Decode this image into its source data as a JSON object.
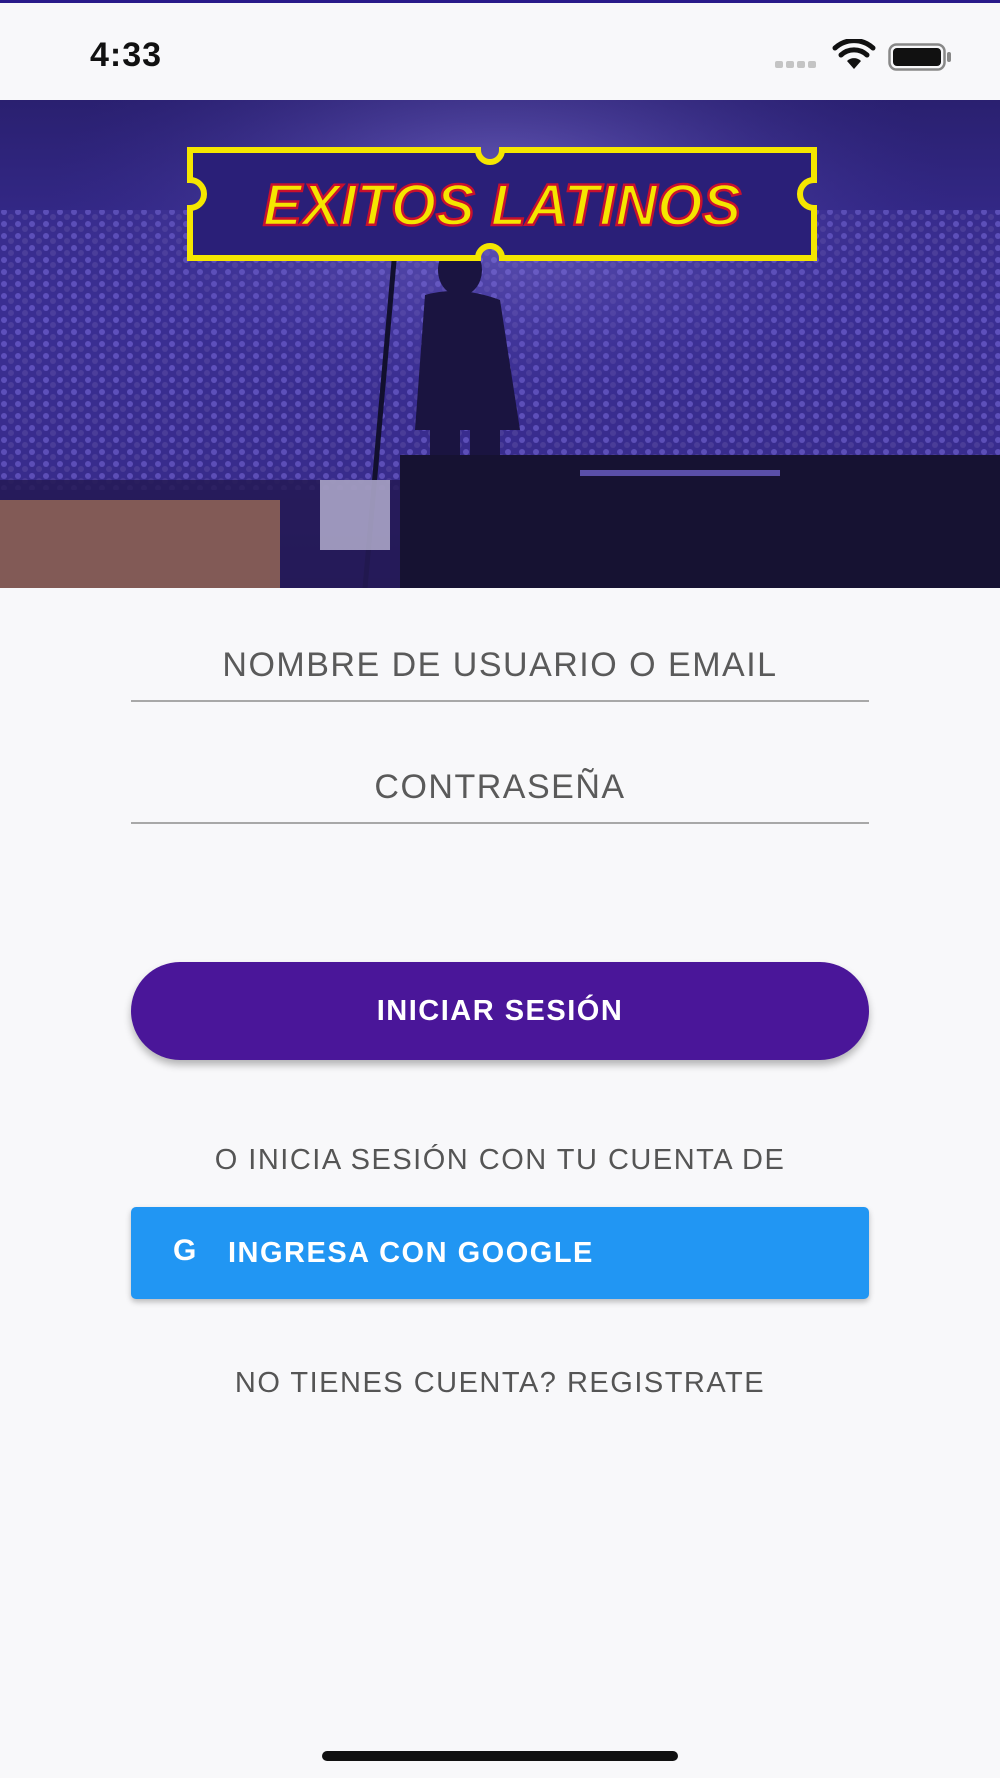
{
  "status_bar": {
    "time": "4:33",
    "icons": [
      "signal-icon",
      "wifi-icon",
      "battery-icon"
    ]
  },
  "hero": {
    "logo_text": "EXITOS LATINOS",
    "colors": {
      "overlay": "#2d1f8a",
      "logo_border": "#f5e600",
      "logo_text_fill": "#f5e600",
      "logo_text_stroke": "#c8102e"
    }
  },
  "login_form": {
    "username_placeholder": "NOMBRE DE USUARIO O EMAIL",
    "password_placeholder": "CONTRASEÑA",
    "submit_label": "INICIAR SESIÓN",
    "alt_label": "O INICIA SESIÓN CON TU CUENTA DE",
    "google_icon": "G",
    "google_label": "INGRESA CON GOOGLE",
    "register_link": "NO TIENES CUENTA? REGISTRATE"
  },
  "colors": {
    "primary": "#4a1699",
    "google": "#2196f3",
    "background": "#f8f8fa",
    "text_muted": "#555555"
  }
}
